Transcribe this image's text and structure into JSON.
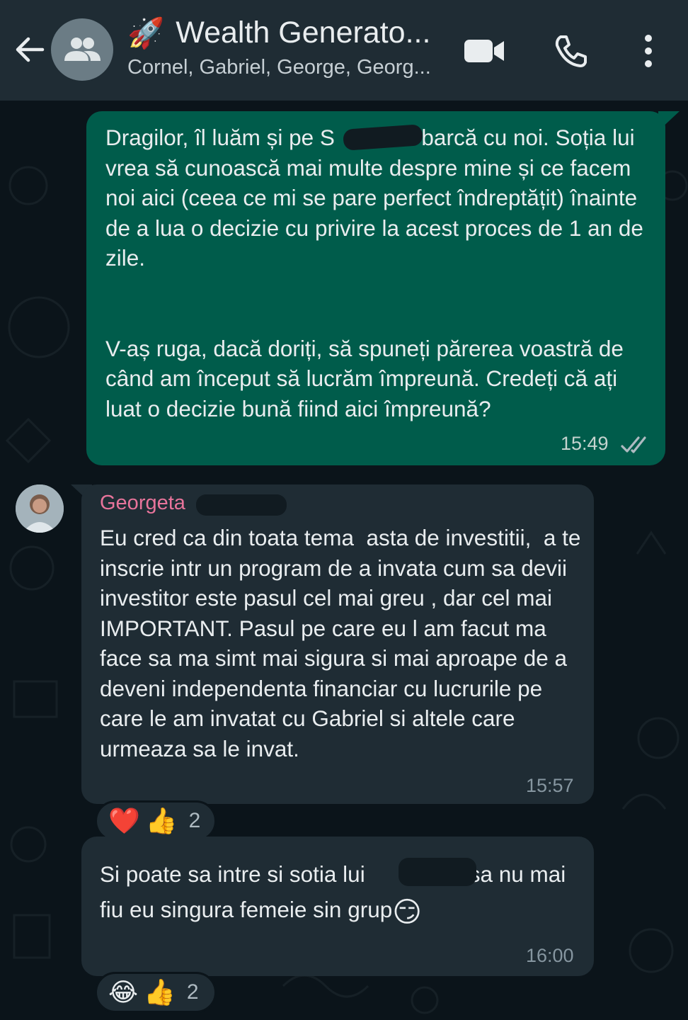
{
  "header": {
    "title_emoji": "🚀",
    "title": "Wealth Generato...",
    "subtitle": "Cornel, Gabriel, George, Georg..."
  },
  "messages": {
    "outgoing": {
      "text": "Dragilor, îl luăm și pe S          în barcă cu noi. Soția lui vrea să cunoască mai multe despre mine și ce facem noi aici (ceea ce mi se pare perfect îndreptățit) înainte de a lua o decizie cu privire la acest proces de 1 an de zile.\n\n\nV-aș ruga, dacă doriți, să spuneți părerea voastră de când am început să lucrăm împreună. Credeți că ați luat o decizie bună fiind aici împreună?",
      "time": "15:49"
    },
    "incoming1": {
      "sender": "Georgeta",
      "text": "Eu cred ca din toata tema  asta de investitii,  a te inscrie intr un program de a invata cum sa devii investitor este pasul cel mai greu , dar cel mai IMPORTANT. Pasul pe care eu l am facut ma face sa ma simt mai sigura si mai aproape de a deveni independenta financiar cu lucrurile pe care le am invatat cu Gabriel si altele care urmeaza sa le invat.",
      "time": "15:57",
      "reactions": {
        "emoji1": "❤️",
        "emoji2": "👍",
        "count": "2"
      }
    },
    "incoming2": {
      "text": "Si poate sa intre si sotia lui            ca sa nu mai fiu eu singura femeie sin grup",
      "emoji": "😏",
      "time": "16:00",
      "reactions": {
        "emoji1": "😂",
        "emoji2": "👍",
        "count": "2"
      }
    }
  },
  "colors": {
    "header_bg": "#1f2c34",
    "chat_bg": "#0b141a",
    "outgoing_bubble": "#005c4b",
    "incoming_bubble": "#1f2c34",
    "sender_name": "#e8749b"
  },
  "icons": [
    "back-arrow-icon",
    "group-icon",
    "video-call-icon",
    "phone-icon",
    "more-vertical-icon",
    "double-check-icon"
  ]
}
